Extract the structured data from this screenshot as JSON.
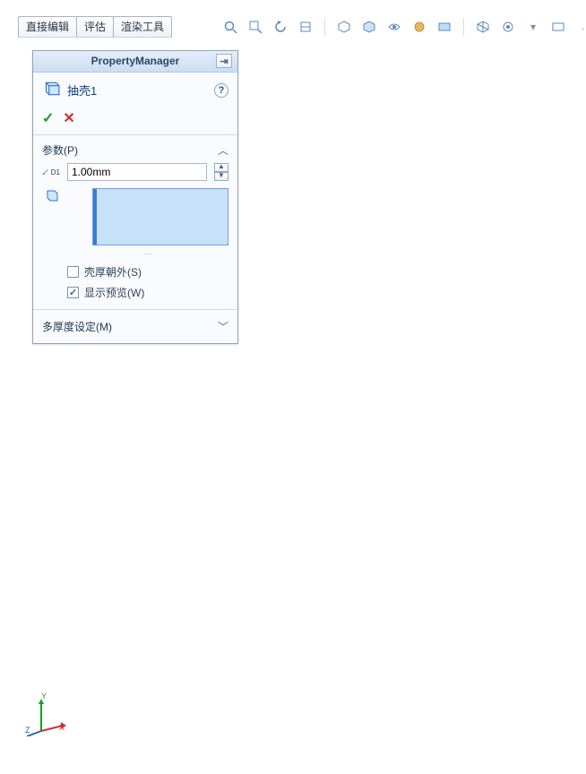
{
  "tabs": {
    "direct_edit": "直接编辑",
    "evaluate": "评估",
    "render_tools": "渲染工具"
  },
  "pm": {
    "title": "PropertyManager",
    "feature_name": "抽壳1",
    "params_label": "参数(P)",
    "thickness_value": "1.00mm",
    "outward_label": "壳厚朝外(S)",
    "outward_checked": false,
    "preview_label": "显示预览(W)",
    "preview_checked": true,
    "multi_thickness_label": "多厚度设定(M)"
  },
  "triad": {
    "x": "X",
    "y": "Y",
    "z": "Z"
  }
}
